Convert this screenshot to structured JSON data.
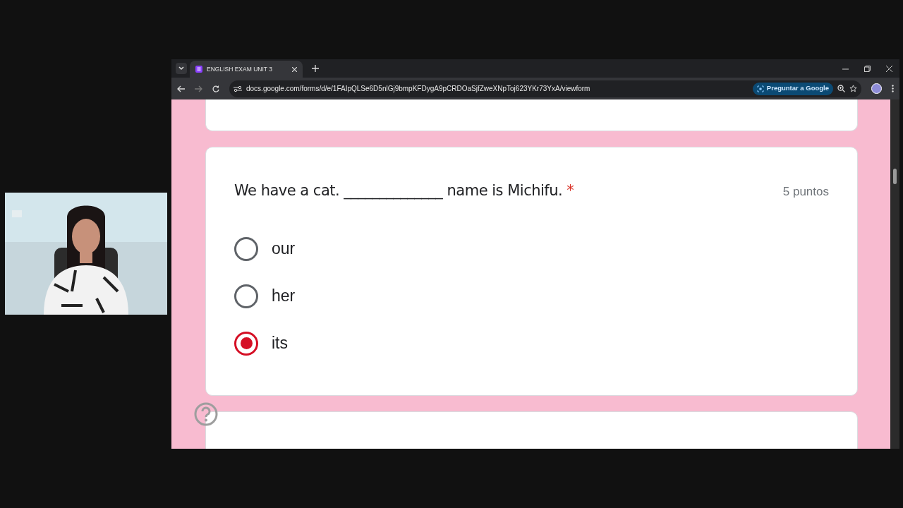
{
  "browser": {
    "tabs": [
      {
        "title": "ENGLISH EXAM UNIT 3",
        "selected": true
      }
    ],
    "url": "docs.google.com/forms/d/e/1FAIpQLSe6D5nlGj9bmpKFDygA9pCRDOaSjfZweXNpToj623YKr73YxA/viewform",
    "ask_button": "Preguntar a Google"
  },
  "question": {
    "text": "We have a cat. ______________ name is Michifu.",
    "required_mark": "*",
    "points": "5 puntos",
    "options": [
      {
        "label": "our",
        "selected": false
      },
      {
        "label": "her",
        "selected": false
      },
      {
        "label": "its",
        "selected": true
      }
    ]
  }
}
